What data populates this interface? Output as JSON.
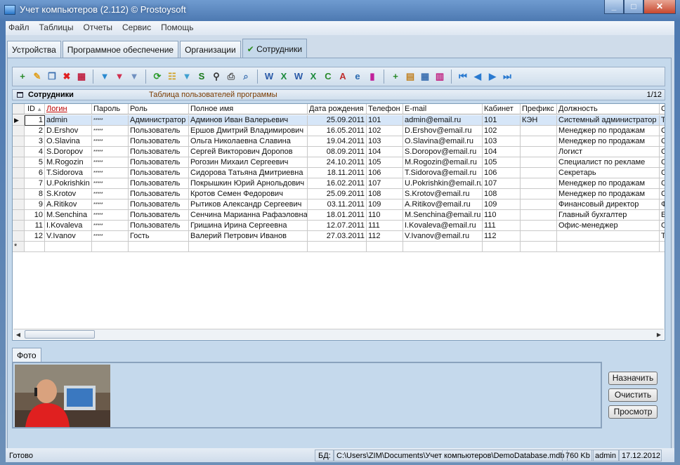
{
  "window": {
    "title": "Учет компьютеров (2.112) © Prostoysoft",
    "buttons": [
      "minimize",
      "maximize",
      "close"
    ]
  },
  "menu": [
    "Файл",
    "Таблицы",
    "Отчеты",
    "Сервис",
    "Помощь"
  ],
  "tabs": [
    {
      "label": "Устройства"
    },
    {
      "label": "Программное обеспечение"
    },
    {
      "label": "Организации"
    },
    {
      "label": "Сотрудники",
      "active": true
    }
  ],
  "toolbar": {
    "groups": [
      [
        "new-record",
        "edit",
        "copy",
        "delete",
        "delete-table"
      ],
      [
        "filter-add",
        "filter-remove",
        "filter-clear"
      ],
      [
        "refresh",
        "tree",
        "view-filter",
        "sql",
        "find",
        "print",
        "print-preview"
      ],
      [
        "word",
        "excel",
        "export-word",
        "export-excel",
        "export-csv",
        "export-text",
        "export-html",
        "chart"
      ],
      [
        "add-field",
        "field-settings",
        "table-settings",
        "columns-settings"
      ],
      [
        "first",
        "prev",
        "next",
        "last"
      ]
    ]
  },
  "table_header": {
    "title": "Сотрудники",
    "description": "Таблица пользователей программы",
    "position": "1/12"
  },
  "grid": {
    "columns": [
      "ID",
      "Логин",
      "Пароль",
      "Роль",
      "Полное имя",
      "Дата рождения",
      "Телефон",
      "E-mail",
      "Кабинет",
      "Префикс",
      "Должность",
      "С"
    ],
    "sort_column": "ID",
    "rows": [
      [
        "1",
        "admin",
        "*****",
        "Администратор",
        "Админов Иван Валерьевич",
        "25.09.2011",
        "101",
        "admin@email.ru",
        "101",
        "КЭН",
        "Системный администратор",
        "Т"
      ],
      [
        "2",
        "D.Ershov",
        "*****",
        "Пользователь",
        "Ершов Дмитрий Владимирович",
        "16.05.2011",
        "102",
        "D.Ershov@email.ru",
        "102",
        "",
        "Менеджер по продажам",
        "С"
      ],
      [
        "3",
        "O.Slavina",
        "*****",
        "Пользователь",
        "Ольга Николаевна Славина",
        "19.04.2011",
        "103",
        "O.Slavina@email.ru",
        "103",
        "",
        "Менеджер по продажам",
        "С"
      ],
      [
        "4",
        "S.Doropov",
        "*****",
        "Пользователь",
        "Сергей Викторович Доропов",
        "08.09.2011",
        "104",
        "S.Doropov@email.ru",
        "104",
        "",
        "Логист",
        "С"
      ],
      [
        "5",
        "M.Rogozin",
        "*****",
        "Пользователь",
        "Рогозин Михаил Сергеевич",
        "24.10.2011",
        "105",
        "M.Rogozin@email.ru",
        "105",
        "",
        "Специалист по рекламе",
        "С"
      ],
      [
        "6",
        "T.Sidorova",
        "*****",
        "Пользователь",
        "Сидорова Татьяна Дмитриевна",
        "18.11.2011",
        "106",
        "T.Sidorova@email.ru",
        "106",
        "",
        "Секретарь",
        "С"
      ],
      [
        "7",
        "U.Pokrishkin",
        "*****",
        "Пользователь",
        "Покрышкин Юрий Арнольдович",
        "16.02.2011",
        "107",
        "U.Pokrishkin@email.ru",
        "107",
        "",
        "Менеджер по продажам",
        "С"
      ],
      [
        "8",
        "S.Krotov",
        "*****",
        "Пользователь",
        "Кротов Семен Федорович",
        "25.09.2011",
        "108",
        "S.Krotov@email.ru",
        "108",
        "",
        "Менеджер по продажам",
        "С"
      ],
      [
        "9",
        "A.Ritikov",
        "*****",
        "Пользователь",
        "Рытиков Александр Сергеевич",
        "03.11.2011",
        "109",
        "A.Ritikov@email.ru",
        "109",
        "",
        "Финансовый директор",
        "Ф"
      ],
      [
        "10",
        "M.Senchina",
        "*****",
        "Пользователь",
        "Сенчина Марианна Рафаэловна",
        "18.01.2011",
        "110",
        "M.Senchina@email.ru",
        "110",
        "",
        "Главный бухгалтер",
        "Б"
      ],
      [
        "11",
        "I.Kovaleva",
        "*****",
        "Пользователь",
        "Гришина Ирина Сергеевна",
        "12.07.2011",
        "111",
        "I.Kovaleva@email.ru",
        "111",
        "",
        "Офис-менеджер",
        "О"
      ],
      [
        "12",
        "V.Ivanov",
        "*****",
        "Гость",
        "Валерий Петрович Иванов",
        "27.03.2011",
        "112",
        "V.Ivanov@email.ru",
        "112",
        "",
        "",
        "Т"
      ]
    ],
    "new_row_marker": "*"
  },
  "photo": {
    "tab": "Фото",
    "buttons": [
      "Назначить",
      "Очистить",
      "Просмотр"
    ]
  },
  "status": {
    "text": "Готово",
    "db_label": "БД:",
    "db_path": "C:\\Users\\ZIM\\Documents\\Учет компьютеров\\DemoDatabase.mdb",
    "size": "760 Kb",
    "user": "admin",
    "date": "17.12.2012"
  }
}
